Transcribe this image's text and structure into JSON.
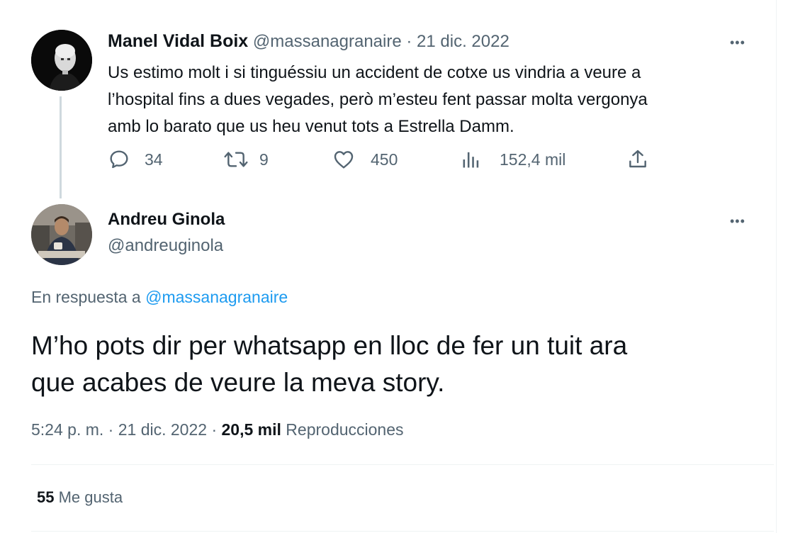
{
  "parent_tweet": {
    "display_name": "Manel Vidal Boix",
    "handle": "@massanagranaire",
    "separator": "·",
    "date": "21 dic. 2022",
    "more": "•••",
    "text_lines": [
      "Us estimo molt i si tinguéssiu un accident de cotxe us vindria a veure a",
      "l’hospital fins a dues vegades, però m’esteu fent passar molta vergonya",
      "amb lo barato que us heu venut tots a Estrella Damm."
    ],
    "actions": {
      "replies": "34",
      "retweets": "9",
      "likes": "450",
      "views": "152,4 mil"
    }
  },
  "main_tweet": {
    "display_name": "Andreu Ginola",
    "handle": "@andreuginola",
    "more": "•••",
    "reply_to_prefix": "En respuesta a",
    "reply_to_handle": "@massanagranaire",
    "text_lines": [
      "M’ho pots dir per whatsapp en lloc de fer un tuit ara",
      "que acabes de veure la meva story."
    ],
    "time": "5:24 p. m.",
    "date": "21 dic. 2022",
    "separator": "·",
    "views_count": "20,5 mil",
    "views_label": "Reproducciones",
    "likes_count": "55",
    "likes_label": "Me gusta"
  },
  "colors": {
    "text": "#0f1419",
    "muted": "#536471",
    "link": "#1d9bf0",
    "divider": "#eff3f4",
    "thread_line": "#cfd9de"
  }
}
